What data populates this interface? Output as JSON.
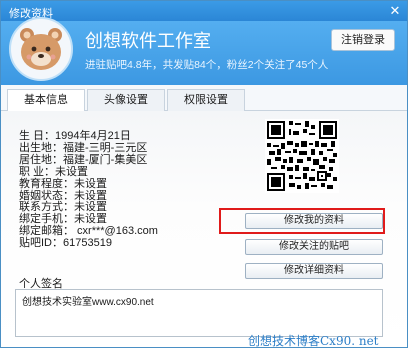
{
  "window": {
    "title": "修改资料",
    "close_icon": "close-icon"
  },
  "header": {
    "studio_name": "创想软件工作室",
    "studio_desc": "进驻贴吧4.8年，共发贴84个，粉丝2个关注了45个人",
    "logout_label": "注销登录"
  },
  "tabs": [
    "基本信息",
    "头像设置",
    "权限设置"
  ],
  "profile": {
    "rows": [
      "生  日：1994年4月21日",
      "出生地：福建-三明-三元区",
      "居住地：福建-厦门-集美区",
      "职  业：未设置",
      "教育程度：未设置",
      "婚姻状态：未设置",
      "联系方式：未设置",
      "绑定手机：未设置",
      "绑定邮箱：  cxr***@163.com",
      "贴吧ID：61753519"
    ]
  },
  "buttons": {
    "edit_profile": "修改我的资料",
    "edit_followed": "修改关注的贴吧",
    "edit_detail": "修改详细资料"
  },
  "signature": {
    "label": "个人签名",
    "text": "创想技术实验室www.cx90.net"
  },
  "watermark": "创想技术博客Cx90. net",
  "colors": {
    "accent": "#3c98e2",
    "highlight": "#e01b1b"
  }
}
